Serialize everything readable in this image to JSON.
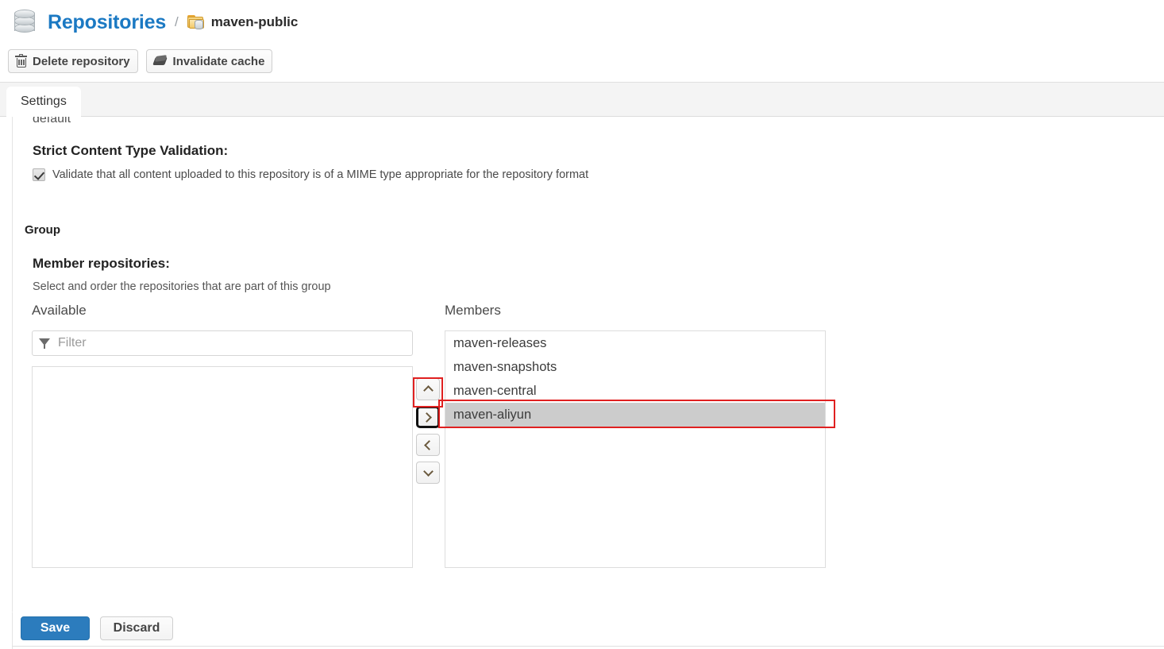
{
  "header": {
    "logo_icon": "database-icon",
    "title": "Repositories",
    "separator": "/",
    "repo_icon": "repository-folder-icon",
    "repo_name": "maven-public"
  },
  "toolbar": {
    "buttons": [
      {
        "label": "Delete repository",
        "icon": "trash-icon"
      },
      {
        "label": "Invalidate cache",
        "icon": "eraser-icon"
      }
    ]
  },
  "tabs": [
    {
      "label": "Settings",
      "active": true
    }
  ],
  "settings": {
    "scrolled_text": "default",
    "strict_validation": {
      "heading": "Strict Content Type Validation:",
      "checkbox_checked": true,
      "checkbox_label": "Validate that all content uploaded to this repository is of a MIME type appropriate for the repository format"
    },
    "group": {
      "section_label": "Group",
      "heading": "Member repositories:",
      "description": "Select and order the repositories that are part of this group",
      "available": {
        "label": "Available",
        "filter_placeholder": "Filter",
        "filter_value": "",
        "filter_icon": "funnel-icon",
        "items": []
      },
      "members": {
        "label": "Members",
        "items": [
          {
            "label": "maven-releases",
            "selected": false
          },
          {
            "label": "maven-snapshots",
            "selected": false
          },
          {
            "label": "maven-central",
            "selected": false
          },
          {
            "label": "maven-aliyun",
            "selected": true
          }
        ]
      },
      "transfer_buttons": [
        {
          "icon": "chevron-up-icon",
          "name": "move-up-button",
          "focused": false,
          "annotated": true
        },
        {
          "icon": "chevron-right-icon",
          "name": "add-to-members-button",
          "focused": true,
          "annotated": false
        },
        {
          "icon": "chevron-left-icon",
          "name": "remove-from-members-button",
          "focused": false,
          "annotated": false
        },
        {
          "icon": "chevron-down-icon",
          "name": "move-down-button",
          "focused": false,
          "annotated": false
        }
      ]
    }
  },
  "footer": {
    "save_label": "Save",
    "discard_label": "Discard"
  },
  "colors": {
    "brand_blue": "#1b79c3",
    "save_blue": "#2c7cbd",
    "selection_gray": "#cccccc",
    "annotation_red": "#e02020"
  }
}
